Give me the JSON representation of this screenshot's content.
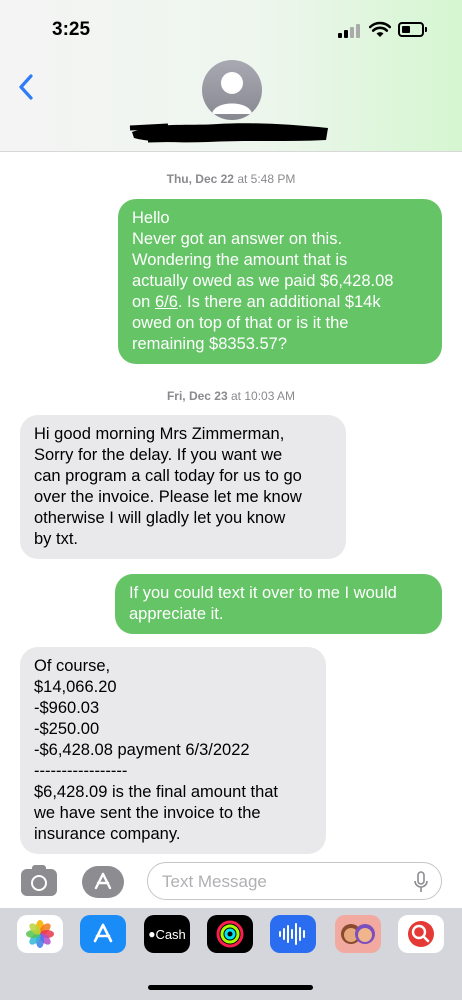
{
  "status_bar": {
    "time": "3:25"
  },
  "header": {
    "back_label": "<"
  },
  "threads": [
    {
      "timestamp_day": "Thu, Dec 22",
      "timestamp_time": "at 5:48 PM"
    },
    {
      "timestamp_day": "Fri, Dec 23",
      "timestamp_time": "at 10:03 AM"
    }
  ],
  "messages": {
    "m1": [
      "Hello",
      "Never got an answer on this.",
      "Wondering the amount that is",
      "actually owed as we paid $6,428.08",
      "on ",
      "6/6",
      ". Is there an additional $14k",
      "owed on top of that or is it the",
      "remaining $8353.57?"
    ],
    "m2": [
      "Hi good morning Mrs Zimmerman,",
      "Sorry for the delay. If you want we",
      "can program a call today for us to go",
      "over the invoice. Please let me know",
      "otherwise I will gladly let you know",
      "by txt."
    ],
    "m3": [
      "If you could text it over to me I would",
      "appreciate it."
    ],
    "m4": [
      "Of course,",
      "$14,066.20",
      "-$960.03",
      "-$250.00",
      "-$6,428.08 payment 6/3/2022",
      "-----------------",
      "$6,428.09 is the final amount that",
      "we have sent the invoice to the",
      "insurance company."
    ]
  },
  "composer": {
    "placeholder": "Text Message"
  },
  "apps": {
    "cash_label": "Cash"
  },
  "colors": {
    "sent": "#65c466",
    "received": "#e9e9eb",
    "accent": "#2f7cf6"
  }
}
